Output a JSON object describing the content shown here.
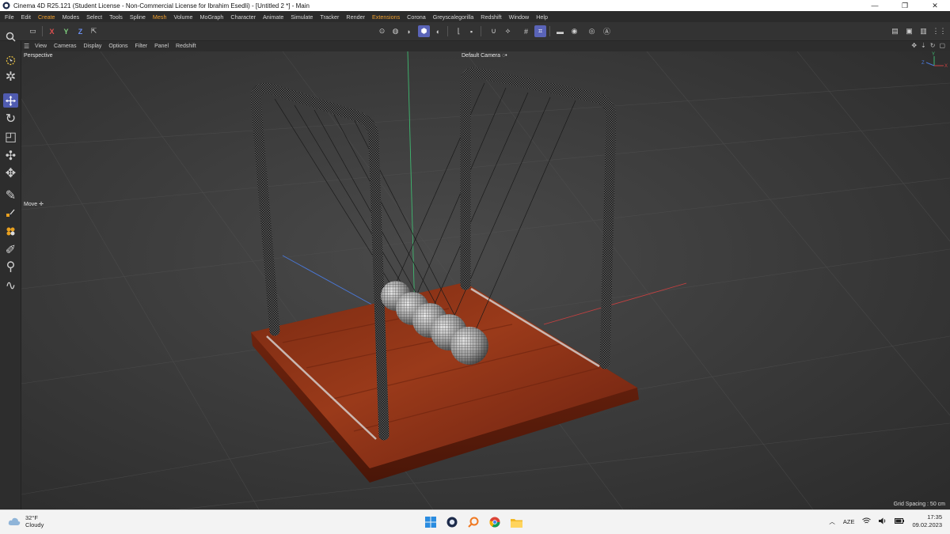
{
  "window": {
    "title": "Cinema 4D R25.121 (Student License - Non-Commercial License for Ibrahim Esedli) - [Untitled 2 *] - Main",
    "controls": [
      "minimize-icon",
      "maximize-icon",
      "close-icon"
    ]
  },
  "menu": [
    "File",
    "Edit",
    "Create",
    "Modes",
    "Select",
    "Tools",
    "Spline",
    "Mesh",
    "Volume",
    "MoGraph",
    "Character",
    "Animate",
    "Simulate",
    "Tracker",
    "Render",
    "Extensions",
    "Corona",
    "Greyscalegorilla",
    "Redshift",
    "Window",
    "Help"
  ],
  "toolbar": {
    "axis_x": "X",
    "axis_y": "Y",
    "axis_z": "Z"
  },
  "viewport_menu": [
    "View",
    "Cameras",
    "Display",
    "Options",
    "Filter",
    "Panel",
    "Redshift"
  ],
  "viewport": {
    "view_name": "Perspective",
    "camera": "Default Camera",
    "camera_icon": "◌•",
    "tool_hint": "Move",
    "grid_spacing": "Grid Spacing : 50 cm",
    "axis_labels": [
      "Y",
      "Z",
      "X"
    ]
  },
  "taskbar": {
    "weather_temp": "32°F",
    "weather_desc": "Cloudy",
    "language": "AZE",
    "time": "17:35",
    "date": "09.02.2023",
    "apps": [
      "windows-start-icon",
      "cinema4d-icon",
      "search-app-icon",
      "chrome-icon",
      "file-explorer-icon"
    ]
  },
  "colors": {
    "accent_active": "#5a64b8",
    "menu_highlight": "#f0a030",
    "wood": "#8a2f16",
    "viewport_bg": "#3a3a3a"
  }
}
